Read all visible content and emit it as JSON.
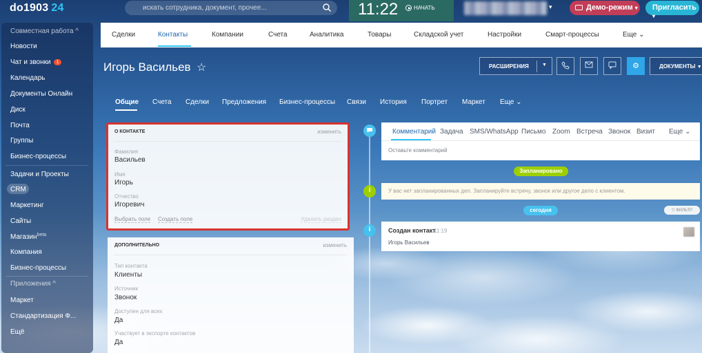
{
  "topbar": {
    "logo_name": "do1903",
    "logo_suffix": "24",
    "search_placeholder": "искать сотрудника, документ, прочее...",
    "clock": "11:22",
    "start_label": "НАЧАТЬ",
    "demo_label": "Демо-режим",
    "invite_label": "Пригласить"
  },
  "sidebar": {
    "section_collab": "Совместная работа ^",
    "items": [
      "Новости",
      "Чат и звонки",
      "Календарь",
      "Документы Онлайн",
      "Диск",
      "Почта",
      "Группы",
      "Бизнес-процессы",
      "Задачи и Проекты",
      "CRM",
      "Маркетинг",
      "Сайты",
      "Магазин",
      "Компания",
      "Бизнес-процессы"
    ],
    "chat_badge": "1",
    "shop_sup": "beta",
    "section_apps": "Приложения ^",
    "apps": [
      "Маркет",
      "Стандартизация Ф...",
      "Ещё"
    ]
  },
  "nav": {
    "items": [
      "Сделки",
      "Контакты",
      "Компании",
      "Счета",
      "Аналитика",
      "Товары",
      "Складской учет",
      "Настройки",
      "Смарт-процессы",
      "Еще ⌄"
    ]
  },
  "contact": {
    "name": "Игорь Васильев"
  },
  "toolbar": {
    "extensions": "РАСШИРЕНИЯ",
    "documents": "ДОКУМЕНТЫ"
  },
  "subtabs": [
    "Общие",
    "Счета",
    "Сделки",
    "Предложения",
    "Бизнес-процессы",
    "Связи",
    "История",
    "Портрет",
    "Маркет",
    "Еще ⌄"
  ],
  "about": {
    "header": "О КОНТАКТЕ",
    "edit": "изменить",
    "fields": [
      {
        "label": "Фамилия",
        "value": "Васильев"
      },
      {
        "label": "Имя",
        "value": "Игорь"
      },
      {
        "label": "Отчество",
        "value": "Игоревич"
      }
    ],
    "choose_field": "Выбрать поле",
    "create_field": "Создать поле",
    "delete_section": "Удалить раздел"
  },
  "extra": {
    "header": "ДОПОЛНИТЕЛЬНО",
    "edit": "изменить",
    "fields": [
      {
        "label": "Тип контакта",
        "value": "Клиенты"
      },
      {
        "label": "Источник",
        "value": "Звонок"
      },
      {
        "label": "Доступен для всех",
        "value": "Да"
      },
      {
        "label": "Участвует в экспорте контактов",
        "value": "Да"
      }
    ]
  },
  "timeline": {
    "tabs": [
      "Комментарий",
      "Задача",
      "SMS/WhatsApp",
      "Письмо",
      "Zoom",
      "Встреча",
      "Звонок",
      "Визит",
      "Еще ⌄"
    ],
    "placeholder": "Оставьте комментарий",
    "planned_label": "Запланировано",
    "notice": "У вас нет запланированных дел. Запланируйте встречу, звонок или другое дело с клиентом.",
    "today_label": "сегодня",
    "filter_label": "ФИЛЬТР",
    "created_title": "Создан контакт",
    "created_time": "11:19",
    "created_name": "Игорь Васильев"
  },
  "colors": {
    "accent": "#2fc6f6",
    "demo": "#c23d57",
    "invite": "#29b6d6",
    "planned": "#9dcf00",
    "highlight_frame": "#d9322f"
  }
}
